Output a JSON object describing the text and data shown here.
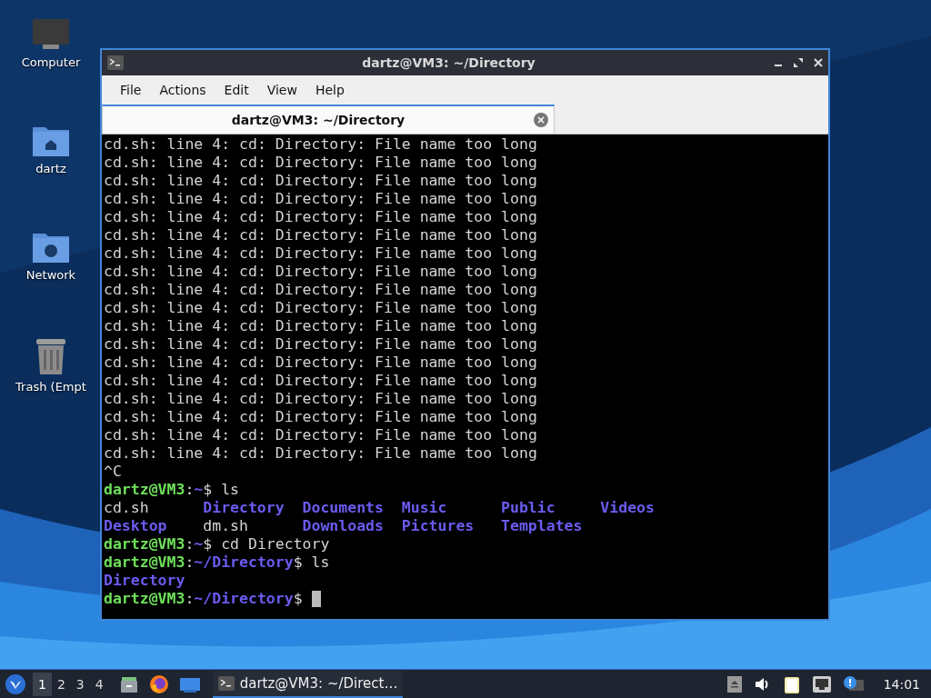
{
  "desktop_icons": [
    {
      "kind": "computer",
      "label": "Computer"
    },
    {
      "kind": "home",
      "label": "dartz"
    },
    {
      "kind": "network",
      "label": "Network"
    },
    {
      "kind": "trash",
      "label": "Trash (Empt"
    }
  ],
  "window": {
    "title": "dartz@VM3: ~/Directory",
    "menu": [
      "File",
      "Actions",
      "Edit",
      "View",
      "Help"
    ],
    "tabs": [
      {
        "label": "dartz@VM3: ~/Directory",
        "selected": true
      }
    ],
    "terminal": {
      "lines": [
        {
          "kind": "text",
          "segments": [
            {
              "kind": "plain",
              "text": "cd.sh: line 4: cd: Directory: File name too long"
            }
          ]
        },
        {
          "kind": "text",
          "segments": [
            {
              "kind": "plain",
              "text": "cd.sh: line 4: cd: Directory: File name too long"
            }
          ]
        },
        {
          "kind": "text",
          "segments": [
            {
              "kind": "plain",
              "text": "cd.sh: line 4: cd: Directory: File name too long"
            }
          ]
        },
        {
          "kind": "text",
          "segments": [
            {
              "kind": "plain",
              "text": "cd.sh: line 4: cd: Directory: File name too long"
            }
          ]
        },
        {
          "kind": "text",
          "segments": [
            {
              "kind": "plain",
              "text": "cd.sh: line 4: cd: Directory: File name too long"
            }
          ]
        },
        {
          "kind": "text",
          "segments": [
            {
              "kind": "plain",
              "text": "cd.sh: line 4: cd: Directory: File name too long"
            }
          ]
        },
        {
          "kind": "text",
          "segments": [
            {
              "kind": "plain",
              "text": "cd.sh: line 4: cd: Directory: File name too long"
            }
          ]
        },
        {
          "kind": "text",
          "segments": [
            {
              "kind": "plain",
              "text": "cd.sh: line 4: cd: Directory: File name too long"
            }
          ]
        },
        {
          "kind": "text",
          "segments": [
            {
              "kind": "plain",
              "text": "cd.sh: line 4: cd: Directory: File name too long"
            }
          ]
        },
        {
          "kind": "text",
          "segments": [
            {
              "kind": "plain",
              "text": "cd.sh: line 4: cd: Directory: File name too long"
            }
          ]
        },
        {
          "kind": "text",
          "segments": [
            {
              "kind": "plain",
              "text": "cd.sh: line 4: cd: Directory: File name too long"
            }
          ]
        },
        {
          "kind": "text",
          "segments": [
            {
              "kind": "plain",
              "text": "cd.sh: line 4: cd: Directory: File name too long"
            }
          ]
        },
        {
          "kind": "text",
          "segments": [
            {
              "kind": "plain",
              "text": "cd.sh: line 4: cd: Directory: File name too long"
            }
          ]
        },
        {
          "kind": "text",
          "segments": [
            {
              "kind": "plain",
              "text": "cd.sh: line 4: cd: Directory: File name too long"
            }
          ]
        },
        {
          "kind": "text",
          "segments": [
            {
              "kind": "plain",
              "text": "cd.sh: line 4: cd: Directory: File name too long"
            }
          ]
        },
        {
          "kind": "text",
          "segments": [
            {
              "kind": "plain",
              "text": "cd.sh: line 4: cd: Directory: File name too long"
            }
          ]
        },
        {
          "kind": "text",
          "segments": [
            {
              "kind": "plain",
              "text": "cd.sh: line 4: cd: Directory: File name too long"
            }
          ]
        },
        {
          "kind": "text",
          "segments": [
            {
              "kind": "plain",
              "text": "cd.sh: line 4: cd: Directory: File name too long"
            }
          ]
        },
        {
          "kind": "text",
          "segments": [
            {
              "kind": "plain",
              "text": "^C"
            }
          ]
        },
        {
          "kind": "text",
          "segments": [
            {
              "kind": "user",
              "text": "dartz@VM3"
            },
            {
              "kind": "plain",
              "text": ":"
            },
            {
              "kind": "path",
              "text": "~"
            },
            {
              "kind": "plain",
              "text": "$ ls"
            }
          ]
        },
        {
          "kind": "columns",
          "segments": [
            {
              "kind": "plain",
              "text": "cd.sh"
            },
            {
              "kind": "dir",
              "text": "Directory"
            },
            {
              "kind": "dir",
              "text": "Documents"
            },
            {
              "kind": "dir",
              "text": "Music"
            },
            {
              "kind": "dir",
              "text": "Public"
            },
            {
              "kind": "dir",
              "text": "Videos"
            }
          ]
        },
        {
          "kind": "columns",
          "segments": [
            {
              "kind": "dir",
              "text": "Desktop"
            },
            {
              "kind": "plain",
              "text": "dm.sh"
            },
            {
              "kind": "dir",
              "text": "Downloads"
            },
            {
              "kind": "dir",
              "text": "Pictures"
            },
            {
              "kind": "dir",
              "text": "Templates"
            }
          ]
        },
        {
          "kind": "text",
          "segments": [
            {
              "kind": "user",
              "text": "dartz@VM3"
            },
            {
              "kind": "plain",
              "text": ":"
            },
            {
              "kind": "path",
              "text": "~"
            },
            {
              "kind": "plain",
              "text": "$ cd Directory"
            }
          ]
        },
        {
          "kind": "text",
          "segments": [
            {
              "kind": "user",
              "text": "dartz@VM3"
            },
            {
              "kind": "plain",
              "text": ":"
            },
            {
              "kind": "path",
              "text": "~/Directory"
            },
            {
              "kind": "plain",
              "text": "$ ls"
            }
          ]
        },
        {
          "kind": "columns",
          "segments": [
            {
              "kind": "dir",
              "text": "Directory"
            }
          ]
        },
        {
          "kind": "text",
          "cursor": true,
          "segments": [
            {
              "kind": "user",
              "text": "dartz@VM3"
            },
            {
              "kind": "plain",
              "text": ":"
            },
            {
              "kind": "path",
              "text": "~/Directory"
            },
            {
              "kind": "plain",
              "text": "$"
            }
          ]
        }
      ]
    }
  },
  "taskbar": {
    "workspaces": [
      {
        "label": "1",
        "selected": true
      },
      {
        "label": "2",
        "selected": false
      },
      {
        "label": "3",
        "selected": false
      },
      {
        "label": "4",
        "selected": false
      }
    ],
    "launchers": [
      {
        "kind": "files"
      },
      {
        "kind": "browser"
      },
      {
        "kind": "desktop"
      }
    ],
    "tasks": [
      {
        "title": "dartz@VM3: ~/Direct…",
        "selected": true
      }
    ],
    "tray": [
      {
        "kind": "eject"
      },
      {
        "kind": "volume"
      },
      {
        "kind": "clipboard"
      },
      {
        "kind": "network"
      },
      {
        "kind": "notice"
      }
    ],
    "clock": "14:01"
  }
}
